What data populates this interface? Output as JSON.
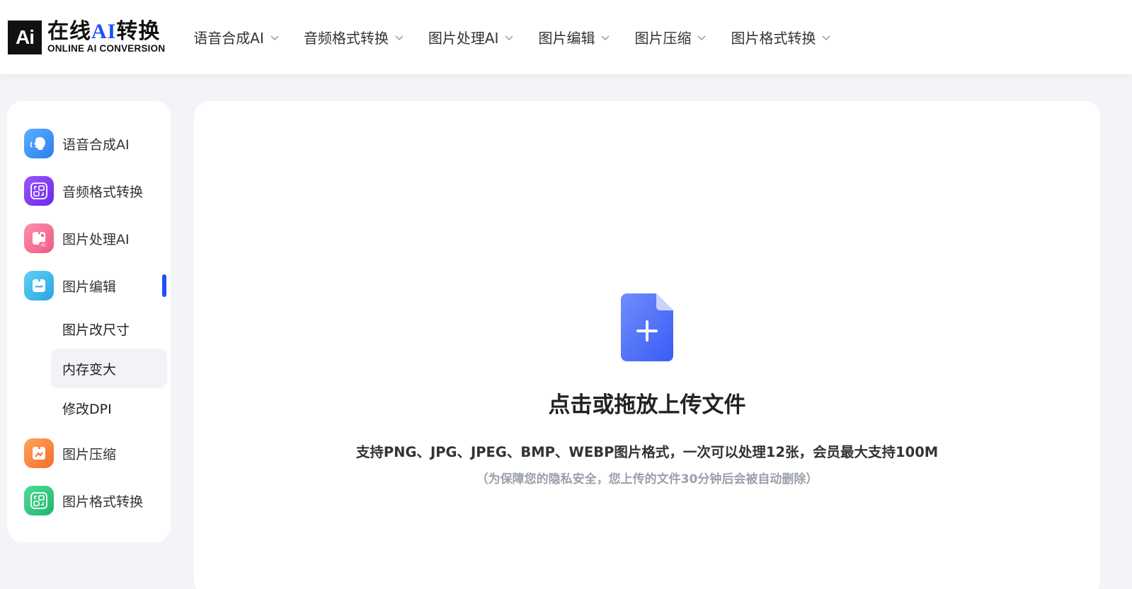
{
  "header": {
    "logo": {
      "mark": "Ai",
      "cn_prefix": "在线",
      "cn_ai": "AI",
      "cn_suffix": "转换",
      "en": "ONLINE AI CONVERSION"
    },
    "nav": [
      {
        "label": "语音合成AI",
        "icon": "chevron-down-icon"
      },
      {
        "label": "音频格式转换",
        "icon": "chevron-down-icon"
      },
      {
        "label": "图片处理AI",
        "icon": "chevron-down-icon"
      },
      {
        "label": "图片编辑",
        "icon": "chevron-down-icon"
      },
      {
        "label": "图片压缩",
        "icon": "chevron-down-icon"
      },
      {
        "label": "图片格式转换",
        "icon": "chevron-down-icon"
      }
    ]
  },
  "sidebar": {
    "items": [
      {
        "label": "语音合成AI",
        "icon": "speech-synthesis-icon",
        "color": "#3a8ef6"
      },
      {
        "label": "音频格式转换",
        "icon": "audio-convert-icon",
        "color": "#7b3ff2"
      },
      {
        "label": "图片处理AI",
        "icon": "image-ai-icon",
        "color": "#f06a8e"
      },
      {
        "label": "图片编辑",
        "icon": "image-edit-icon",
        "color": "#36b3e8"
      },
      {
        "label": "图片压缩",
        "icon": "image-compress-icon",
        "color": "#f7823a"
      },
      {
        "label": "图片格式转换",
        "icon": "image-format-icon",
        "color": "#2ec27e"
      }
    ],
    "sub_items": [
      {
        "label": "图片改尺寸"
      },
      {
        "label": "内存变大"
      },
      {
        "label": "修改DPI"
      }
    ],
    "active_item": "图片编辑",
    "active_sub_item": "内存变大"
  },
  "upload": {
    "icon": "file-add-icon",
    "title": "点击或拖放上传文件",
    "description": "支持PNG、JPG、JPEG、BMP、WEBP图片格式，一次可以处理12张，会员最大支持100M",
    "note": "（为保障您的隐私安全，您上传的文件30分钟后会被自动删除）"
  },
  "colors": {
    "accent": "#1e4fff",
    "background": "#f3f4f8"
  }
}
